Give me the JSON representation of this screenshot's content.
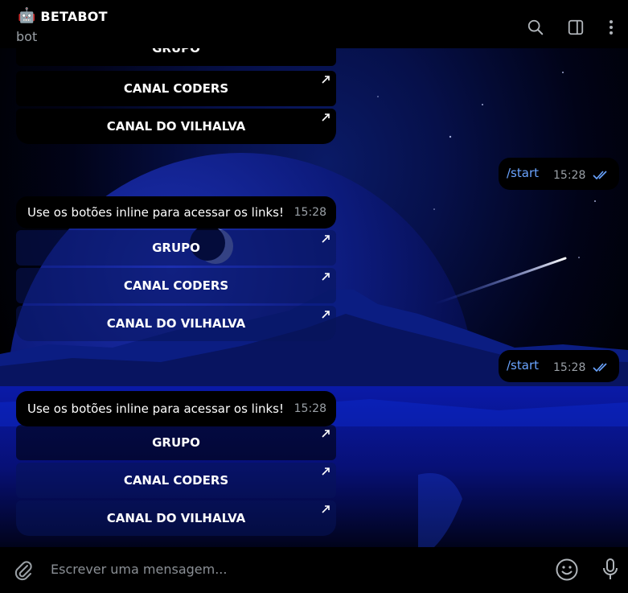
{
  "header": {
    "title": "BETABOT",
    "subtitle": "bot",
    "robot_glyph": "🤖",
    "icons": [
      "search-icon",
      "sidebar-toggle-icon",
      "more-vert-icon"
    ]
  },
  "messages": {
    "partial_top_button": "GRUPO",
    "top_buttons": [
      "CANAL CODERS",
      "CANAL DO VILHALVA"
    ],
    "out1": {
      "text": "/start",
      "time": "15:28"
    },
    "in1": {
      "text": "Use os botões inline para acessar os links!",
      "time": "15:28",
      "buttons": [
        "GRUPO",
        "CANAL CODERS",
        "CANAL DO VILHALVA"
      ]
    },
    "out2": {
      "text": "/start",
      "time": "15:28"
    },
    "in2": {
      "text": "Use os botões inline para acessar os links!",
      "time": "15:28",
      "buttons": [
        "GRUPO",
        "CANAL CODERS",
        "CANAL DO VILHALVA"
      ]
    }
  },
  "composer": {
    "placeholder": "Escrever uma mensagem...",
    "icons": [
      "attach-icon",
      "emoji-icon",
      "mic-icon"
    ]
  },
  "colors": {
    "accent_link": "#6aa4ff",
    "bubble_bg": "#000000",
    "button_bg": "#0b1a5e",
    "muted_text": "#9aa0a6"
  }
}
